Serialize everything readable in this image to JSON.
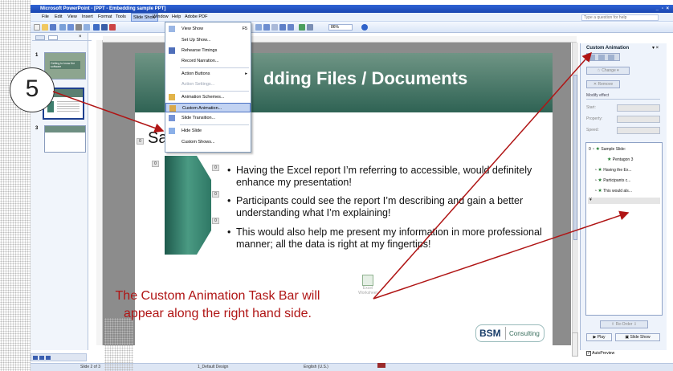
{
  "window": {
    "title": "Microsoft PowerPoint - [PPT - Embedding sample PPT]",
    "controls": "_ ▫ ×"
  },
  "menubar": {
    "items": [
      "File",
      "Edit",
      "View",
      "Insert",
      "Format",
      "Tools",
      "Slide Show",
      "Window",
      "Help",
      "Adobe PDF"
    ],
    "help_placeholder": "Type a question for help"
  },
  "toolbar": {
    "zoom": "86%"
  },
  "slideshow_menu": {
    "items": [
      {
        "label": "View Show",
        "shortcut": "F5",
        "disabled": false
      },
      {
        "label": "Set Up Show...",
        "disabled": false
      },
      {
        "label": "Rehearse Timings",
        "disabled": false
      },
      {
        "label": "Record Narration...",
        "disabled": false
      },
      {
        "label": "Action Buttons",
        "disabled": false,
        "submenu": true
      },
      {
        "label": "Action Settings...",
        "disabled": true
      },
      {
        "label": "Animation Schemes...",
        "disabled": false
      },
      {
        "label": "Custom Animation...",
        "disabled": false,
        "highlighted": true
      },
      {
        "label": "Slide Transition...",
        "disabled": false
      },
      {
        "label": "Hide Slide",
        "disabled": false
      },
      {
        "label": "Custom Shows...",
        "disabled": false
      }
    ]
  },
  "thumbnails": [
    {
      "num": "1",
      "text": "Getting to know the software"
    },
    {
      "num": "2",
      "text": ""
    },
    {
      "num": "3",
      "text": ""
    }
  ],
  "slide": {
    "title": "dding Files / Documents",
    "subtitle": "Sa",
    "bullets": [
      "Having the Excel report I’m referring to accessible, would definitely enhance my presentation!",
      "Participants could see the report I’m describing and gain a better understanding what I’m explaining!",
      "This would also help me present my information in more professional manner; all the data is right at my fingertips!"
    ],
    "tags": {
      "subtitle": "0",
      "pentagon": "0",
      "b1": "0",
      "b2": "0",
      "b3": "0"
    },
    "excel_label": "Excel Worksheet",
    "logo": {
      "brand": "BSM",
      "word": "Consulting"
    }
  },
  "task_pane": {
    "title": "Custom Animation",
    "change_btn": "Change",
    "remove_btn": "Remove",
    "modify_label": "Modify effect",
    "start_label": "Start:",
    "property_label": "Property:",
    "speed_label": "Speed:",
    "anim_items": [
      {
        "order": "0",
        "label": "Sample Slide:"
      },
      {
        "order": "",
        "label": "Pentagon 3"
      },
      {
        "order": "",
        "label": "Having the Ex..."
      },
      {
        "order": "",
        "label": "Participants c..."
      },
      {
        "order": "",
        "label": "This would als..."
      }
    ],
    "reorder_label": "Re-Order",
    "play_btn": "Play",
    "slideshow_btn": "Slide Show",
    "autopreview_label": "AutoPreview"
  },
  "statusbar": {
    "slide": "Slide 2 of 3",
    "design": "1_Default Design",
    "language": "English (U.S.)"
  },
  "annotation": {
    "step": "5",
    "caption_line1": "The Custom Animation Task Bar will",
    "caption_line2": "appear along the right hand side.",
    "color": "#b01515"
  }
}
